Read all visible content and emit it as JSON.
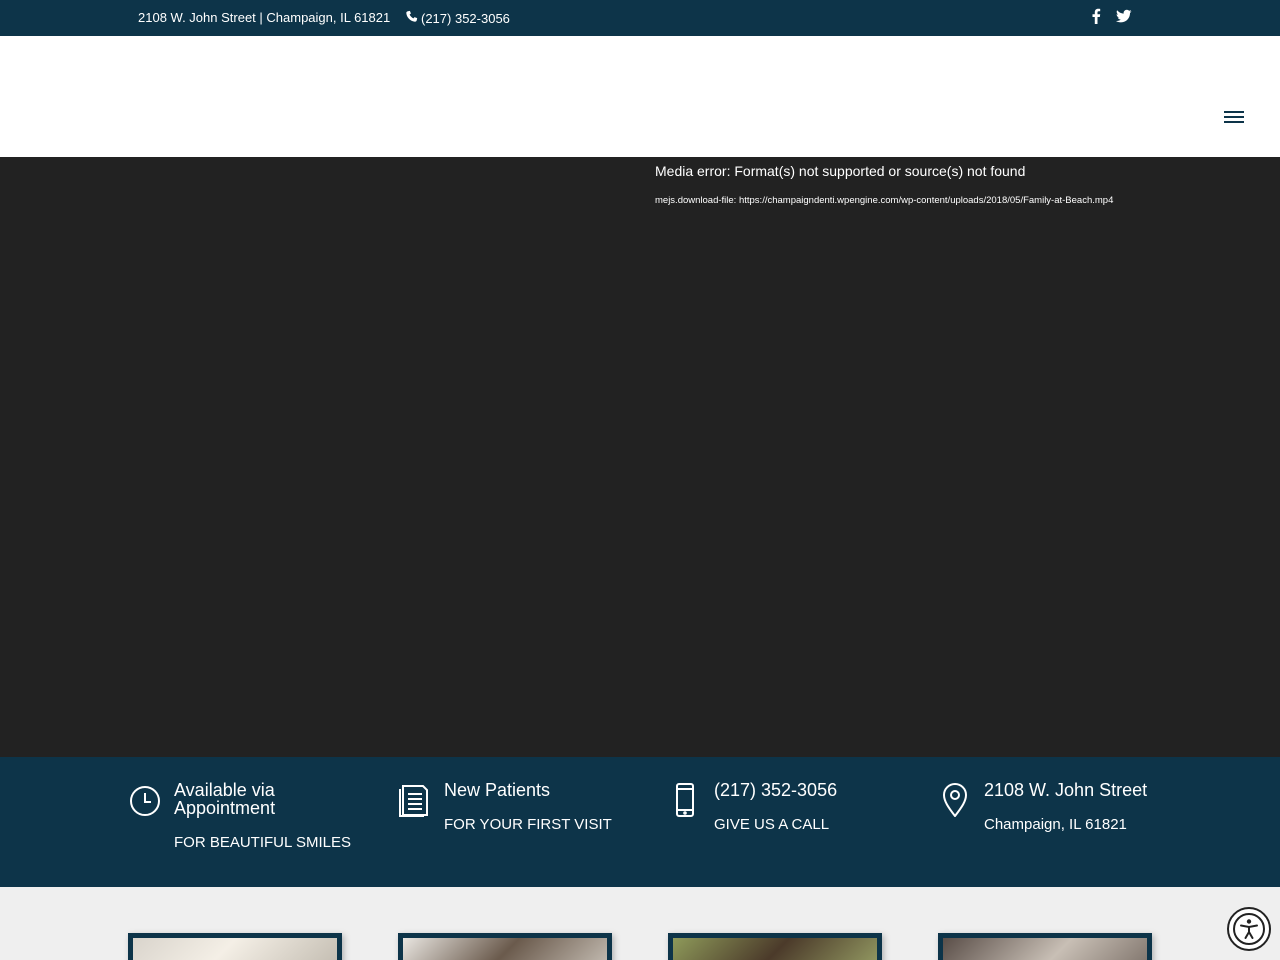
{
  "topbar": {
    "address": "2108 W. John Street | Champaign, IL 61821",
    "phone": "(217) 352-3056",
    "social_icons": [
      "facebook-icon",
      "twitter-icon"
    ]
  },
  "header": {
    "menu_icon": "hamburger-menu-icon"
  },
  "video": {
    "error_message": "Media error: Format(s) not supported or source(s) not found",
    "download_link": "mejs.download-file: https://champaigndenti.wpengine.com/wp-content/uploads/2018/05/Family-at-Beach.mp4"
  },
  "info": [
    {
      "icon": "clock-icon",
      "title": "Available via Appointment",
      "subtitle": "FOR BEAUTIFUL SMILES"
    },
    {
      "icon": "document-icon",
      "title": "New Patients",
      "subtitle": "FOR YOUR FIRST VISIT"
    },
    {
      "icon": "mobile-phone-icon",
      "title": "(217) 352-3056",
      "subtitle": "GIVE US A CALL"
    },
    {
      "icon": "map-pin-icon",
      "title": "2108 W. John Street",
      "subtitle": "Champaign, IL 61821"
    }
  ],
  "colors": {
    "brand_navy": "#0d3449",
    "video_bg": "#222222",
    "cards_bg": "#efefef"
  },
  "accessibility": {
    "icon": "accessibility-icon"
  }
}
